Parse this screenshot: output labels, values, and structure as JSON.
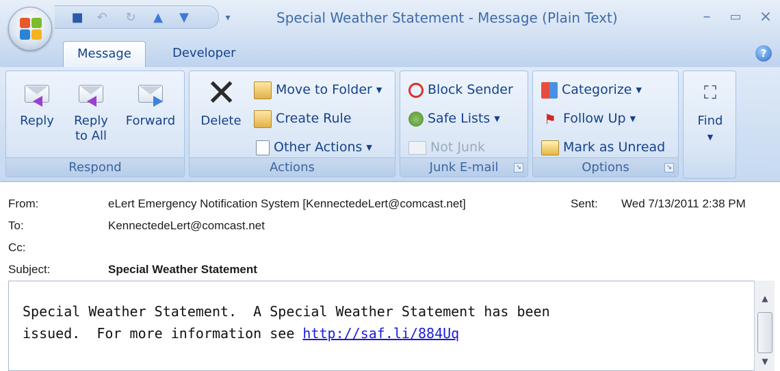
{
  "window": {
    "title": "Special Weather Statement - Message (Plain Text)"
  },
  "tabs": [
    {
      "label": "Message",
      "active": true
    },
    {
      "label": "Developer",
      "active": false
    }
  ],
  "ribbon": {
    "respond": {
      "label": "Respond",
      "reply": "Reply",
      "reply_all_1": "Reply",
      "reply_all_2": "to All",
      "forward": "Forward"
    },
    "actions": {
      "label": "Actions",
      "delete": "Delete",
      "move_to_folder": "Move to Folder",
      "create_rule": "Create Rule",
      "other_actions": "Other Actions"
    },
    "junk": {
      "label": "Junk E-mail",
      "block_sender": "Block Sender",
      "safe_lists": "Safe Lists",
      "not_junk": "Not Junk"
    },
    "options": {
      "label": "Options",
      "categorize": "Categorize",
      "follow_up": "Follow Up",
      "mark_as_unread": "Mark as Unread"
    },
    "find": {
      "label": "Find"
    }
  },
  "header": {
    "from_label": "From:",
    "from_value": "eLert Emergency Notification System [KennectedeLert@comcast.net]",
    "sent_label": "Sent:",
    "sent_value": "Wed 7/13/2011 2:38 PM",
    "to_label": "To:",
    "to_value": "KennectedeLert@comcast.net",
    "cc_label": "Cc:",
    "subject_label": "Subject:",
    "subject_value": "Special Weather Statement"
  },
  "body": {
    "line1": "Special Weather Statement.  A Special Weather Statement has been",
    "line2_prefix": "issued.  For more information see ",
    "link": "http://saf.li/884Uq"
  },
  "colors": {
    "accent": "#15428b",
    "link": "#1a1adb"
  }
}
